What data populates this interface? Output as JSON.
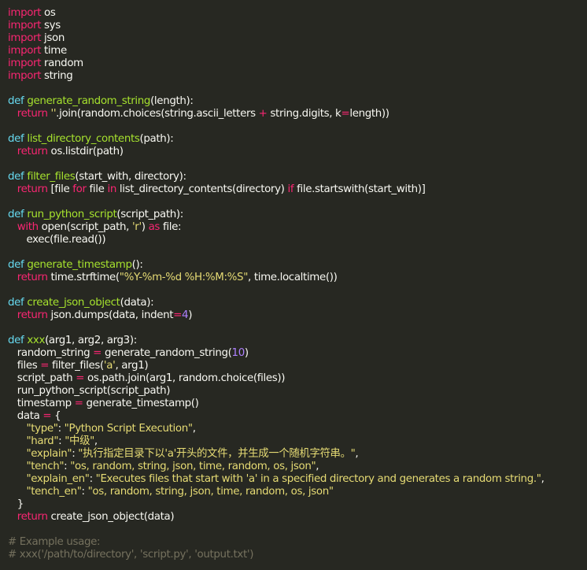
{
  "colors": {
    "background": "#272822",
    "text": "#f8f8f2",
    "keyword": "#f92672",
    "def": "#66d9ef",
    "function": "#a6e22e",
    "string": "#e6db74",
    "number": "#ae81ff",
    "operator": "#f92672",
    "comment": "#75715e"
  },
  "code": {
    "lines": [
      [
        [
          "kw",
          "import"
        ],
        [
          "txt",
          " os"
        ]
      ],
      [
        [
          "kw",
          "import"
        ],
        [
          "txt",
          " sys"
        ]
      ],
      [
        [
          "kw",
          "import"
        ],
        [
          "txt",
          " json"
        ]
      ],
      [
        [
          "kw",
          "import"
        ],
        [
          "txt",
          " time"
        ]
      ],
      [
        [
          "kw",
          "import"
        ],
        [
          "txt",
          " random"
        ]
      ],
      [
        [
          "kw",
          "import"
        ],
        [
          "txt",
          " string"
        ]
      ],
      [],
      [
        [
          "def",
          "def"
        ],
        [
          "txt",
          " "
        ],
        [
          "fn",
          "generate_random_string"
        ],
        [
          "txt",
          "(length):"
        ]
      ],
      [
        [
          "txt",
          "   "
        ],
        [
          "kw",
          "return"
        ],
        [
          "txt",
          " "
        ],
        [
          "str",
          "''"
        ],
        [
          "txt",
          ".join(random.choices(string.ascii_letters "
        ],
        [
          "op",
          "+"
        ],
        [
          "txt",
          " string.digits, k"
        ],
        [
          "op",
          "="
        ],
        [
          "txt",
          "length))"
        ]
      ],
      [],
      [
        [
          "def",
          "def"
        ],
        [
          "txt",
          " "
        ],
        [
          "fn",
          "list_directory_contents"
        ],
        [
          "txt",
          "(path):"
        ]
      ],
      [
        [
          "txt",
          "   "
        ],
        [
          "kw",
          "return"
        ],
        [
          "txt",
          " os.listdir(path)"
        ]
      ],
      [],
      [
        [
          "def",
          "def"
        ],
        [
          "txt",
          " "
        ],
        [
          "fn",
          "filter_files"
        ],
        [
          "txt",
          "(start_with, directory):"
        ]
      ],
      [
        [
          "txt",
          "   "
        ],
        [
          "kw",
          "return"
        ],
        [
          "txt",
          " [file "
        ],
        [
          "kw",
          "for"
        ],
        [
          "txt",
          " file "
        ],
        [
          "kw",
          "in"
        ],
        [
          "txt",
          " list_directory_contents(directory) "
        ],
        [
          "kw",
          "if"
        ],
        [
          "txt",
          " file.startswith(start_with)]"
        ]
      ],
      [],
      [
        [
          "def",
          "def"
        ],
        [
          "txt",
          " "
        ],
        [
          "fn",
          "run_python_script"
        ],
        [
          "txt",
          "(script_path):"
        ]
      ],
      [
        [
          "txt",
          "   "
        ],
        [
          "kw",
          "with"
        ],
        [
          "txt",
          " open(script_path, "
        ],
        [
          "str",
          "'r'"
        ],
        [
          "txt",
          ") "
        ],
        [
          "kw",
          "as"
        ],
        [
          "txt",
          " file:"
        ]
      ],
      [
        [
          "txt",
          "      exec(file.read())"
        ]
      ],
      [],
      [
        [
          "def",
          "def"
        ],
        [
          "txt",
          " "
        ],
        [
          "fn",
          "generate_timestamp"
        ],
        [
          "txt",
          "():"
        ]
      ],
      [
        [
          "txt",
          "   "
        ],
        [
          "kw",
          "return"
        ],
        [
          "txt",
          " time.strftime("
        ],
        [
          "str",
          "\"%Y-%m-%d %H:%M:%S\""
        ],
        [
          "txt",
          ", time.localtime())"
        ]
      ],
      [],
      [
        [
          "def",
          "def"
        ],
        [
          "txt",
          " "
        ],
        [
          "fn",
          "create_json_object"
        ],
        [
          "txt",
          "(data):"
        ]
      ],
      [
        [
          "txt",
          "   "
        ],
        [
          "kw",
          "return"
        ],
        [
          "txt",
          " json.dumps(data, indent"
        ],
        [
          "op",
          "="
        ],
        [
          "num",
          "4"
        ],
        [
          "txt",
          ")"
        ]
      ],
      [],
      [
        [
          "def",
          "def"
        ],
        [
          "txt",
          " "
        ],
        [
          "fn",
          "xxx"
        ],
        [
          "txt",
          "(arg1, arg2, arg3):"
        ]
      ],
      [
        [
          "txt",
          "   random_string "
        ],
        [
          "op",
          "="
        ],
        [
          "txt",
          " generate_random_string("
        ],
        [
          "num",
          "10"
        ],
        [
          "txt",
          ")"
        ]
      ],
      [
        [
          "txt",
          "   files "
        ],
        [
          "op",
          "="
        ],
        [
          "txt",
          " filter_files("
        ],
        [
          "str",
          "'a'"
        ],
        [
          "txt",
          ", arg1)"
        ]
      ],
      [
        [
          "txt",
          "   script_path "
        ],
        [
          "op",
          "="
        ],
        [
          "txt",
          " os.path.join(arg1, random.choice(files))"
        ]
      ],
      [
        [
          "txt",
          "   run_python_script(script_path)"
        ]
      ],
      [
        [
          "txt",
          "   timestamp "
        ],
        [
          "op",
          "="
        ],
        [
          "txt",
          " generate_timestamp()"
        ]
      ],
      [
        [
          "txt",
          "   data "
        ],
        [
          "op",
          "="
        ],
        [
          "txt",
          " {"
        ]
      ],
      [
        [
          "txt",
          "      "
        ],
        [
          "str",
          "\"type\""
        ],
        [
          "txt",
          ": "
        ],
        [
          "str",
          "\"Python Script Execution\""
        ],
        [
          "txt",
          ","
        ]
      ],
      [
        [
          "txt",
          "      "
        ],
        [
          "str",
          "\"hard\""
        ],
        [
          "txt",
          ": "
        ],
        [
          "str",
          "\"中级\""
        ],
        [
          "txt",
          ","
        ]
      ],
      [
        [
          "txt",
          "      "
        ],
        [
          "str",
          "\"explain\""
        ],
        [
          "txt",
          ": "
        ],
        [
          "str",
          "\"执行指定目录下以'a'开头的文件，并生成一个随机字符串。\""
        ],
        [
          "txt",
          ","
        ]
      ],
      [
        [
          "txt",
          "      "
        ],
        [
          "str",
          "\"tench\""
        ],
        [
          "txt",
          ": "
        ],
        [
          "str",
          "\"os, random, string, json, time, random, os, json\""
        ],
        [
          "txt",
          ","
        ]
      ],
      [
        [
          "txt",
          "      "
        ],
        [
          "str",
          "\"explain_en\""
        ],
        [
          "txt",
          ": "
        ],
        [
          "str",
          "\"Executes files that start with 'a' in a specified directory and generates a random string.\""
        ],
        [
          "txt",
          ","
        ]
      ],
      [
        [
          "txt",
          "      "
        ],
        [
          "str",
          "\"tench_en\""
        ],
        [
          "txt",
          ": "
        ],
        [
          "str",
          "\"os, random, string, json, time, random, os, json\""
        ]
      ],
      [
        [
          "txt",
          "   }"
        ]
      ],
      [
        [
          "txt",
          "   "
        ],
        [
          "kw",
          "return"
        ],
        [
          "txt",
          " create_json_object(data)"
        ]
      ],
      [],
      [
        [
          "cmt",
          "# Example usage:"
        ]
      ],
      [
        [
          "cmt",
          "# xxx('/path/to/directory', 'script.py', 'output.txt')"
        ]
      ]
    ]
  }
}
